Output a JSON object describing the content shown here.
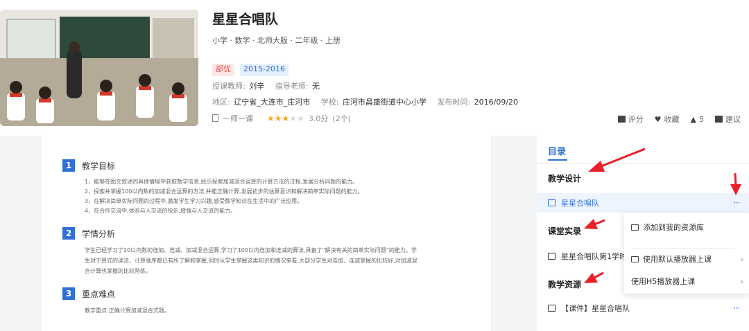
{
  "header": {
    "title": "星星合唱队",
    "subtitle": "小学 · 数学 · 北师大版 · 二年级 · 上册",
    "tags": [
      "部优",
      "2015-2016"
    ],
    "teacher_label": "授课教师:",
    "teacher": "刘辛",
    "advisor_label": "指导老师:",
    "advisor": "无",
    "region_label": "地区:",
    "region": "辽宁省_大连市_庄河市",
    "school_label": "学校:",
    "school": "庄河市昌盛街道中心小学",
    "date_label": "发布时间:",
    "date": "2016/09/20",
    "course_type": "一师一课",
    "rating": 3,
    "rating_max": 5,
    "score": "3.0分",
    "rating_count": "(2个)"
  },
  "actions": {
    "rate": "评分",
    "favorite": "收藏",
    "like": "5",
    "suggest": "建议"
  },
  "document": {
    "sections": [
      {
        "num": "1",
        "title": "教学目标",
        "items": [
          "1、能够在图文叙述的具体情境中获取数学信息,经历探索加减混合运算的计算方法的过程,发展分析问题的能力。",
          "2、探索并掌握100以内数的加减混合运算的方法,并能正确计算,发展初步的估算意识和解决简单实际问题的能力。",
          "3、在解决简单实际问题的过程中,激发学生学习兴趣,感受数学知识在生活中的广泛应用。",
          "4、在合作交流中,体验与人交流的快乐,增强与人交流的能力。"
        ]
      },
      {
        "num": "2",
        "title": "学情分析",
        "text": "学生已经学习了20以内数的连加、连减、加减混合运算,学习了100以内连加和连减的算法,具备了“解决有关的简单实际问题”的能力。学生对于算式的读法、计算顺序都已有所了解和掌握,同时从学生掌握这类知识的情况来看,大部分学生对连加、连减掌握的比较好,对加减混合计算也掌握的比较熟练。"
      },
      {
        "num": "3",
        "title": "重点难点",
        "text": "教学重点:正确计算加减混合式题。"
      }
    ]
  },
  "sidebar": {
    "toc": "目录",
    "cat_design": "教学设计",
    "design_item": "星星合唱队",
    "cat_record": "课堂实录",
    "record_item": "星星合唱队第1学时",
    "cat_resource": "教学资源",
    "resource_item": "【课件】星星合唱队",
    "dots": "···"
  },
  "menu": {
    "add": "添加到我的资源库",
    "default_player": "使用默认播放器上课",
    "h5_player": "使用H5播放器上课",
    "chevron": "›"
  },
  "colors": {
    "accent": "#2f6fd6",
    "arrow": "#e8202a",
    "star": "#f5a623"
  }
}
